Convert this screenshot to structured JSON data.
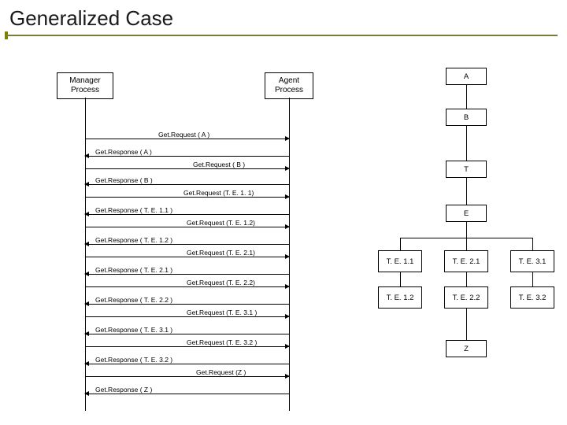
{
  "title": "Generalized Case",
  "lifelines": {
    "manager": "Manager\nProcess",
    "agent": "Agent\nProcess"
  },
  "tree": {
    "A": "A",
    "B": "B",
    "T": "T",
    "E": "E",
    "Z": "Z",
    "leaves": {
      "te11": "T. E. 1.1",
      "te21": "T. E. 2.1",
      "te31": "T. E. 3.1",
      "te12": "T. E. 1.2",
      "te22": "T. E. 2.2",
      "te32": "T. E. 3.2"
    }
  },
  "messages": {
    "req_A": "Get.Request ( A )",
    "res_A": "Get.Response ( A )",
    "req_B": "Get.Request ( B )",
    "res_B": "Get.Response ( B )",
    "req_11": "Get.Request (T. E. 1. 1)",
    "res_11": "Get.Response ( T. E. 1.1 )",
    "req_12": "Get.Request (T. E. 1.2)",
    "res_12": "Get.Response ( T. E. 1.2 )",
    "req_21": "Get.Request (T. E. 2.1)",
    "res_21": "Get.Response ( T. E. 2.1 )",
    "req_22": "Get.Request (T. E. 2.2)",
    "res_22": "Get.Response ( T. E. 2.2 )",
    "req_31": "Get.Request (T. E. 3.1 )",
    "res_31": "Get.Response ( T. E. 3.1 )",
    "req_32": "Get.Request (T. E. 3.2 )",
    "res_32": "Get.Response ( T. E. 3.2 )",
    "req_Z": "Get.Request (Z )",
    "res_Z": "Get.Response ( Z )"
  }
}
